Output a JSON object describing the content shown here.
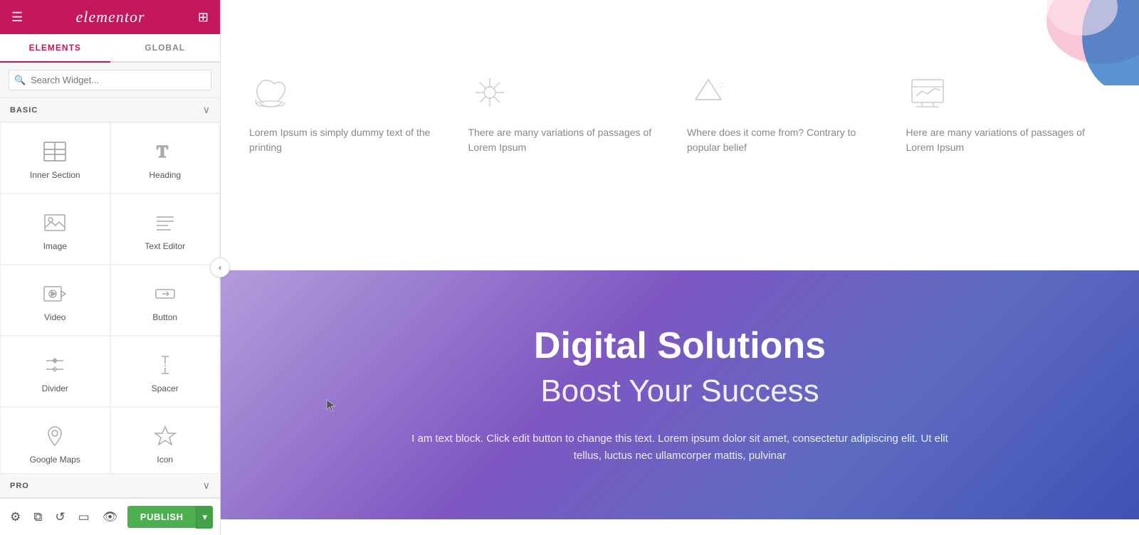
{
  "sidebar": {
    "logo": "elementor",
    "tabs": [
      {
        "label": "ELEMENTS",
        "active": true
      },
      {
        "label": "GLOBAL",
        "active": false
      }
    ],
    "search": {
      "placeholder": "Search Widget..."
    },
    "sections": {
      "basic": {
        "label": "BASIC",
        "widgets": [
          {
            "id": "inner-section",
            "label": "Inner Section",
            "icon": "inner-section-icon"
          },
          {
            "id": "heading",
            "label": "Heading",
            "icon": "heading-icon"
          },
          {
            "id": "image",
            "label": "Image",
            "icon": "image-icon"
          },
          {
            "id": "text-editor",
            "label": "Text Editor",
            "icon": "text-editor-icon"
          },
          {
            "id": "video",
            "label": "Video",
            "icon": "video-icon"
          },
          {
            "id": "button",
            "label": "Button",
            "icon": "button-icon"
          },
          {
            "id": "divider",
            "label": "Divider",
            "icon": "divider-icon"
          },
          {
            "id": "spacer",
            "label": "Spacer",
            "icon": "spacer-icon"
          },
          {
            "id": "google-maps",
            "label": "Google Maps",
            "icon": "google-maps-icon"
          },
          {
            "id": "icon",
            "label": "Icon",
            "icon": "icon-widget-icon"
          }
        ]
      },
      "pro": {
        "label": "PRO"
      }
    },
    "footer": {
      "publish_label": "PUBLISH"
    }
  },
  "canvas": {
    "features": [
      {
        "text": "Lorem Ipsum is simply dummy text of the printing"
      },
      {
        "text": "There are many variations of passages of Lorem Ipsum"
      },
      {
        "text": "Where does it come from? Contrary to popular belief"
      },
      {
        "text": "Here are many variations of passages of Lorem Ipsum"
      }
    ],
    "hero": {
      "title": "Digital Solutions",
      "subtitle": "Boost Your Success",
      "body": "I am text block. Click edit button to change this text. Lorem ipsum dolor sit amet, consectetur adipiscing elit. Ut elit tellus, luctus nec ullamcorper mattis, pulvinar"
    }
  }
}
